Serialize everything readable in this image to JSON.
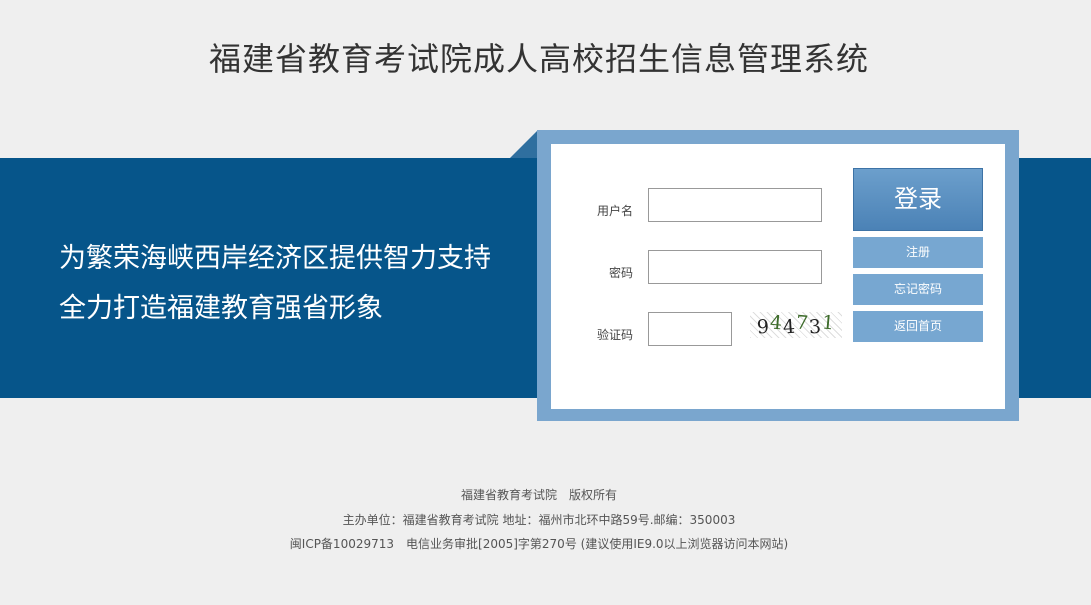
{
  "header": {
    "title": "福建省教育考试院成人高校招生信息管理系统"
  },
  "banner": {
    "slogan_line1": "为繁荣海峡西岸经济区提供智力支持",
    "slogan_line2": "全力打造福建教育强省形象"
  },
  "login": {
    "username_label": "用户名",
    "username_value": "",
    "password_label": "密码",
    "password_value": "",
    "captcha_label": "验证码",
    "captcha_value": "",
    "captcha_image_text": "944731",
    "login_button": "登录",
    "register_button": "注册",
    "forgot_password_button": "忘记密码",
    "home_button": "返回首页"
  },
  "footer": {
    "line1": "福建省教育考试院　版权所有",
    "line2": "主办单位：福建省教育考试院 地址：福州市北环中路59号.邮编：350003",
    "line3": "闽ICP备10029713　电信业务审批[2005]字第270号 (建议使用IE9.0以上浏览器访问本网站)"
  },
  "colors": {
    "banner": "#06558a",
    "panel_frame": "#7aa6ce",
    "button": "#77a7d1",
    "background": "#efefef"
  }
}
